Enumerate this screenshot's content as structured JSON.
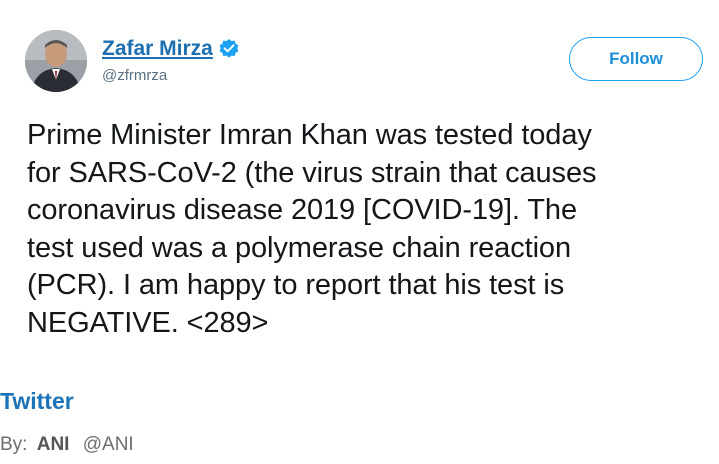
{
  "tweet": {
    "display_name": "Zafar Mirza",
    "handle": "@zfrmrza",
    "verified_icon": "verified-badge-icon",
    "follow_label": "Follow",
    "text_lines": [
      "Prime Minister Imran Khan was tested today",
      "for SARS-CoV-2 (the virus strain that causes",
      "coronavirus disease 2019 [COVID-19]. The",
      "test used was a polymerase chain reaction",
      "(PCR). I am happy to report that his test is",
      "NEGATIVE. <289>"
    ]
  },
  "source": {
    "label": "Twitter"
  },
  "byline": {
    "prefix": "By:",
    "author": "ANI",
    "author_handle": "@ANI"
  },
  "colors": {
    "link_blue": "#1c6fb0",
    "follow_border": "#1da1f2",
    "verified_blue": "#1da1f2",
    "text": "#14171a"
  }
}
